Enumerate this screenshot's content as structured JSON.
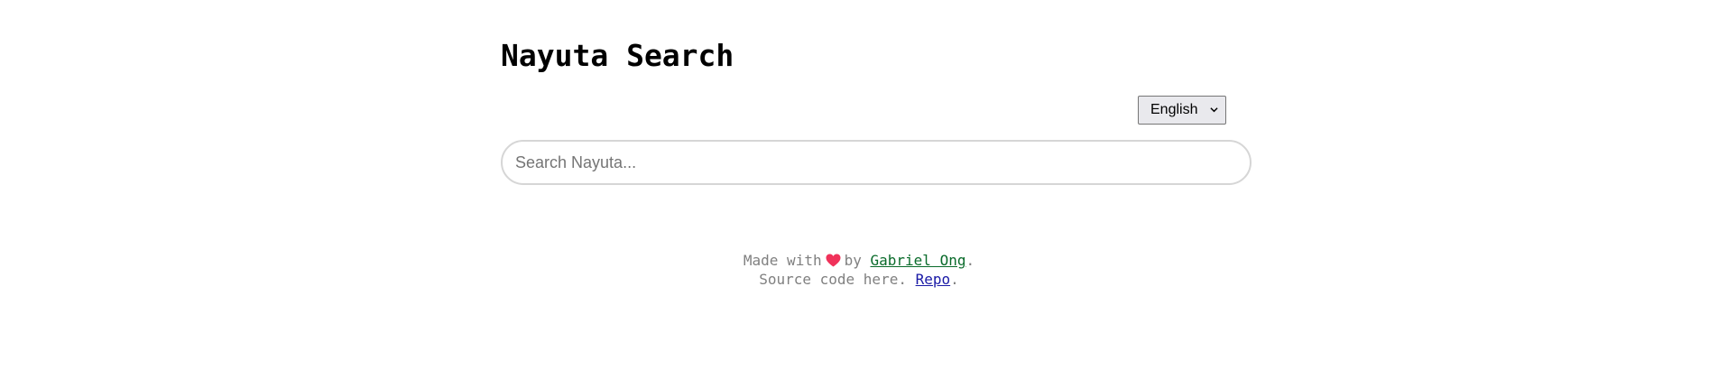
{
  "header": {
    "title": "Nayuta Search"
  },
  "language": {
    "selected": "English"
  },
  "search": {
    "placeholder": "Search Nayuta...",
    "value": ""
  },
  "footer": {
    "made_with": "Made with",
    "by": "by",
    "author": "Gabriel Ong",
    "period1": ".",
    "source_text": "Source code here.",
    "repo": "Repo",
    "period2": ".",
    "heart_icon": "heart-icon",
    "heart_color": "#f0325a"
  },
  "colors": {
    "author_link": "#0a6b2b",
    "repo_link": "#1a1aa6",
    "footer_text": "#808080"
  }
}
